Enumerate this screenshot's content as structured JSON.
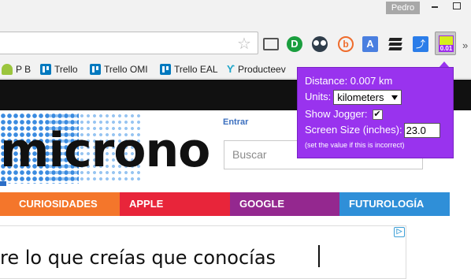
{
  "window": {
    "profile_name": "Pedro"
  },
  "toolbar": {
    "ext_green_letter": "D",
    "ext_b_letter": "b",
    "ext_translate_letter": "A",
    "jogger_badge": "0.01",
    "more": "»"
  },
  "bookmarks": [
    {
      "label": "P B",
      "icon": "android-icon"
    },
    {
      "label": "Trello",
      "icon": "trello-icon"
    },
    {
      "label": "Trello OMI",
      "icon": "trello-icon"
    },
    {
      "label": "Trello EAL",
      "icon": "trello-icon"
    },
    {
      "label": "Producteev",
      "icon": "producteev-icon"
    }
  ],
  "site": {
    "logo_text": "microno",
    "login_label": "Entrar",
    "search_placeholder": "Buscar"
  },
  "categories": [
    {
      "label": "CURIOSIDADES",
      "color": "#f4762b"
    },
    {
      "label": "APPLE",
      "color": "#e8253a"
    },
    {
      "label": "GOOGLE",
      "color": "#94288f"
    },
    {
      "label": "FUTUROLOGÍA",
      "color": "#2f8fd8"
    }
  ],
  "ad": {
    "text": "re lo que creías que conocías",
    "adchoices_label": "▷"
  },
  "popup": {
    "distance_label": "Distance: 0.007 km",
    "units_label": "Units:",
    "units_value": "kilometers",
    "show_jogger_label": "Show Jogger:",
    "show_jogger_checked": true,
    "screen_size_label": "Screen Size (inches):",
    "screen_size_value": "23.0",
    "note": "(set the value if this is incorrect)",
    "bg_color": "#9933ee"
  }
}
